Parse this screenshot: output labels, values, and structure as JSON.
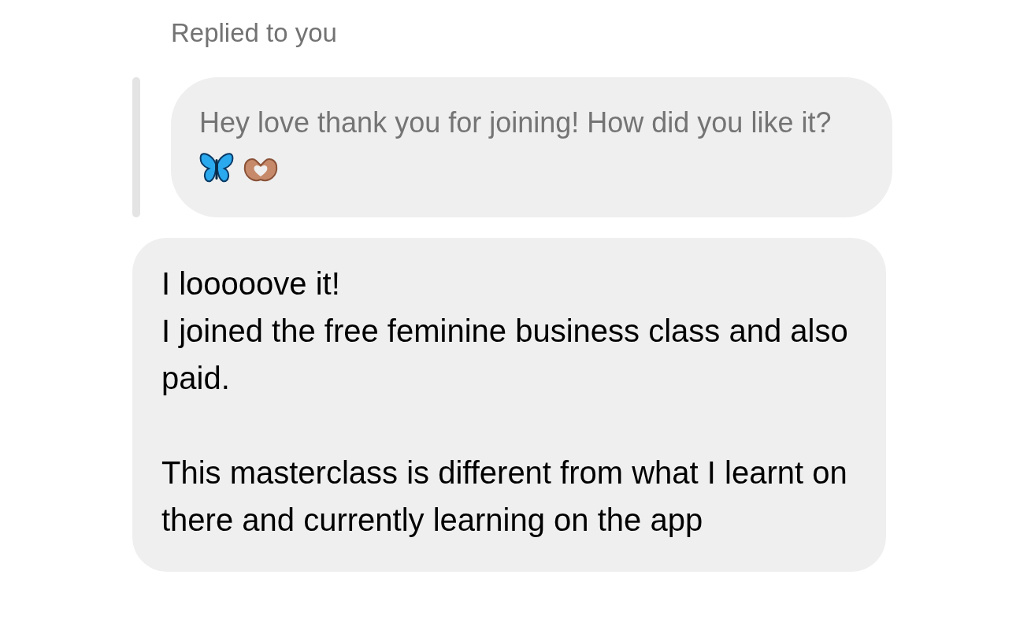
{
  "reply_label": "Replied to you",
  "quoted_message": {
    "text": "Hey love thank you for joining! How did you like it?"
  },
  "message": {
    "text": "I looooove it!\nI joined the free feminine business class and also paid.\n\nThis masterclass is different from what I learnt on there and currently learning on the app"
  }
}
